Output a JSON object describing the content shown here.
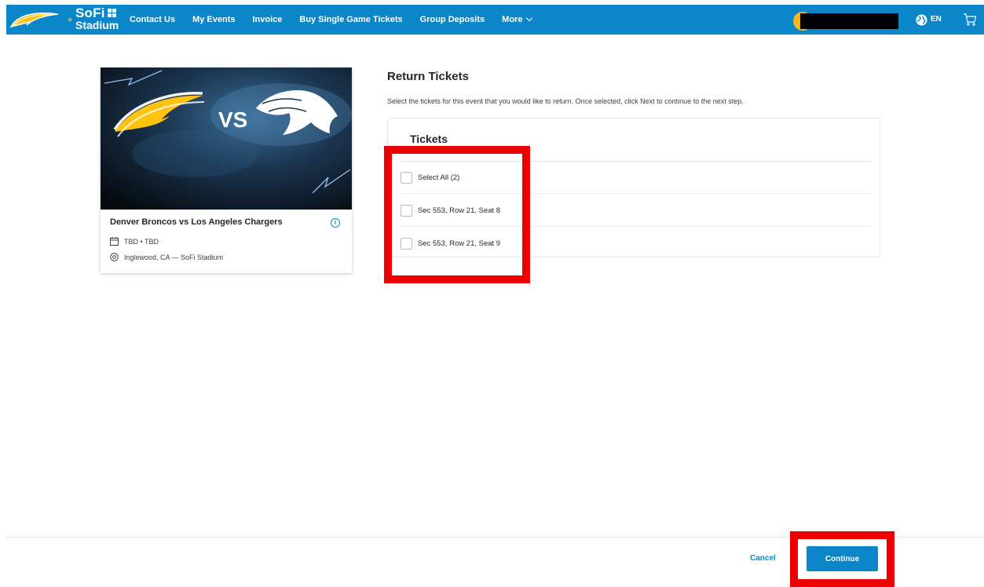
{
  "nav": {
    "brand_line1": "SoFi",
    "brand_line2": "Stadium",
    "items": [
      {
        "label": "Contact Us"
      },
      {
        "label": "My Events"
      },
      {
        "label": "Invoice"
      },
      {
        "label": "Buy Single Game Tickets"
      },
      {
        "label": "Group Deposits"
      },
      {
        "label": "More"
      }
    ],
    "language": "EN",
    "icons": [
      "chargers-bolt-logo",
      "globe-icon",
      "cart-icon",
      "chevron-down-icon"
    ]
  },
  "event": {
    "image_text": "VS",
    "title": "Denver Broncos vs Los Angeles Chargers",
    "date": "TBD • TBD",
    "location": "Inglewood, CA — SoFi Stadium",
    "icons": [
      "calendar-icon",
      "location-pin-icon",
      "info-icon"
    ]
  },
  "return": {
    "title": "Return Tickets",
    "description": "Select the tickets for this event that you would like to return. Once selected, click Next to continue to the next step.",
    "tickets_heading": "Tickets",
    "rows": [
      {
        "label": "Select All (2)",
        "checked": false
      },
      {
        "label": "Sec 553, Row 21, Seat 8",
        "checked": false
      },
      {
        "label": "Sec 553, Row 21, Seat 9",
        "checked": false
      }
    ]
  },
  "footer": {
    "cancel_label": "Cancel",
    "continue_label": "Continue"
  },
  "colors": {
    "brand_blue": "#0a86c9",
    "gold": "#ffc20e",
    "highlight_red": "#ef0000"
  }
}
